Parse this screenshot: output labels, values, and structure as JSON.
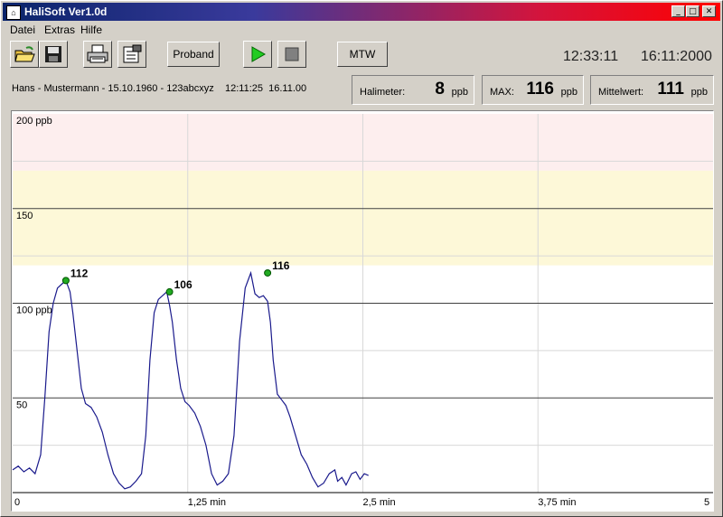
{
  "window": {
    "title": "HaliSoft Ver1.0d",
    "app_icon": "halisoft-app-icon"
  },
  "menu": [
    "Datei",
    "Extras",
    "Hilfe"
  ],
  "toolbar": {
    "icons": [
      "open-folder-icon",
      "save-disk-icon",
      "printer-icon",
      "settings-icon"
    ],
    "proband_label": "Proband",
    "mtw_label": "MTW"
  },
  "clock": {
    "time": "12:33:11",
    "date": "16:11:2000"
  },
  "patient_info": "Hans - Mustermann - 15.10.1960 - 123abcxyz    12:11:25  16.11.00",
  "stats": {
    "halimeter": {
      "label": "Halimeter:",
      "value": "8",
      "unit": "ppb"
    },
    "max": {
      "label": "MAX:",
      "value": "116",
      "unit": "ppb"
    },
    "mittelwert": {
      "label": "Mittelwert:",
      "value": "111",
      "unit": "ppb"
    }
  },
  "colors": {
    "zone_high": "#fdeeee",
    "zone_mid": "#fdf8d8",
    "trace": "#1a1a8c",
    "peak_marker": "#22aa22",
    "play": "#22cc22"
  },
  "chart_data": {
    "type": "line",
    "x_ticks": [
      "0",
      "1,25  min",
      "2,5  min",
      "3,75  min",
      "5"
    ],
    "y_ticks": [
      "200  ppb",
      "150",
      "100  ppb",
      "50"
    ],
    "xlim": [
      0,
      5
    ],
    "ylim": [
      0,
      200
    ],
    "bands": [
      {
        "from": 170,
        "to": 200,
        "color": "#fdeeee"
      },
      {
        "from": 120,
        "to": 170,
        "color": "#fdf8d8"
      }
    ],
    "peaks": [
      {
        "x": 0.38,
        "y": 112,
        "label": "112"
      },
      {
        "x": 1.12,
        "y": 106,
        "label": "106"
      },
      {
        "x": 1.82,
        "y": 116,
        "label": "116"
      }
    ],
    "series": [
      {
        "x": [
          0,
          0.04,
          0.08,
          0.12,
          0.16,
          0.2,
          0.23,
          0.26,
          0.29,
          0.32,
          0.35,
          0.38,
          0.41,
          0.43,
          0.46,
          0.49,
          0.52,
          0.56,
          0.6,
          0.64,
          0.68,
          0.72,
          0.76,
          0.8,
          0.84,
          0.88,
          0.92,
          0.95,
          0.98,
          1.01,
          1.04,
          1.07,
          1.1,
          1.12,
          1.14,
          1.17,
          1.2,
          1.23,
          1.26,
          1.3,
          1.34,
          1.38,
          1.42,
          1.46,
          1.5,
          1.54,
          1.58,
          1.62,
          1.66,
          1.7,
          1.73,
          1.76,
          1.79,
          1.82,
          1.84,
          1.86,
          1.89,
          1.92,
          1.95,
          1.98,
          2.02,
          2.06,
          2.1,
          2.14,
          2.18,
          2.22,
          2.26,
          2.3,
          2.32,
          2.35,
          2.38,
          2.42,
          2.45,
          2.48,
          2.51,
          2.54
        ],
        "y": [
          12,
          14,
          11,
          13,
          10,
          20,
          50,
          85,
          100,
          108,
          110,
          112,
          106,
          95,
          75,
          55,
          47,
          45,
          40,
          32,
          20,
          10,
          5,
          2,
          3,
          6,
          10,
          30,
          70,
          95,
          102,
          104,
          106,
          99,
          90,
          70,
          55,
          48,
          46,
          42,
          35,
          25,
          10,
          4,
          6,
          10,
          30,
          80,
          108,
          116,
          105,
          103,
          104,
          101,
          90,
          70,
          52,
          49,
          46,
          40,
          30,
          20,
          15,
          8,
          3,
          5,
          10,
          12,
          6,
          8,
          4,
          10,
          11,
          7,
          10,
          9
        ]
      }
    ]
  }
}
